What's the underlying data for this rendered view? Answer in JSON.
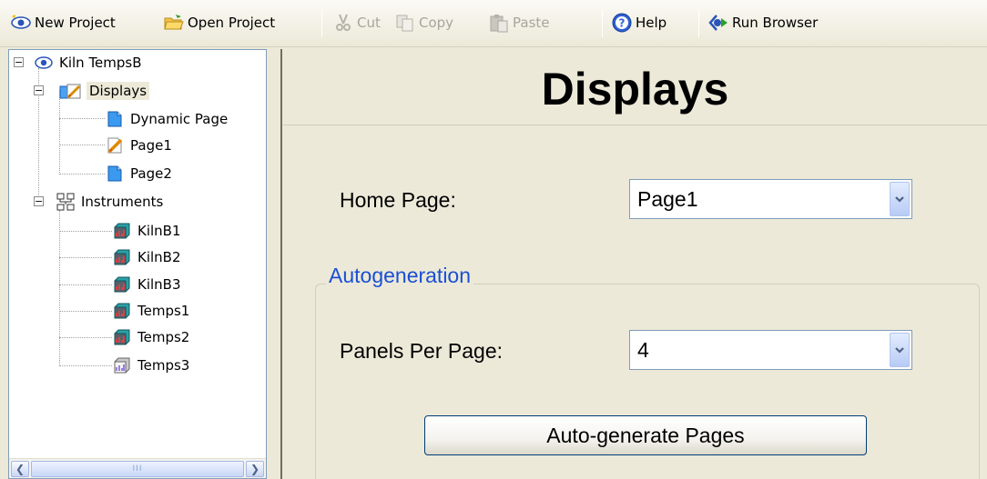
{
  "toolbar": {
    "new_project": "New Project",
    "open_project": "Open Project",
    "cut": "Cut",
    "copy": "Copy",
    "paste": "Paste",
    "help": "Help",
    "run_browser": "Run Browser"
  },
  "tree": {
    "root": "Kiln TempsB",
    "displays": {
      "label": "Displays",
      "pages": [
        "Dynamic Page",
        "Page1",
        "Page2"
      ]
    },
    "instruments": {
      "label": "Instruments",
      "items": [
        "KilnB1",
        "KilnB2",
        "KilnB3",
        "Temps1",
        "Temps2",
        "Temps3"
      ]
    }
  },
  "scrollbar": {
    "thumb_grip": "III"
  },
  "main": {
    "title": "Displays",
    "home_page_label": "Home Page:",
    "home_page_value": "Page1",
    "autogen_legend": "Autogeneration",
    "panels_label": "Panels Per Page:",
    "panels_value": "4",
    "autogen_button": "Auto-generate Pages"
  },
  "colors": {
    "window_bg": "#ece9d8",
    "legend_blue": "#1a4fd6",
    "field_border": "#7f9db9"
  }
}
